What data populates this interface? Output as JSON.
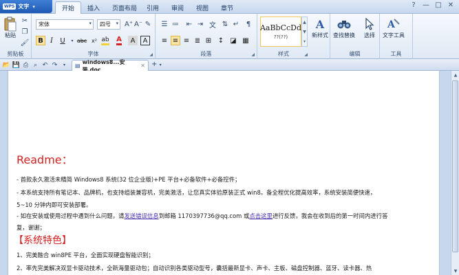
{
  "app": {
    "logo": "WPS",
    "title": "文字",
    "caret": "▾"
  },
  "tabs": [
    "开始",
    "插入",
    "页面布局",
    "引用",
    "审阅",
    "视图",
    "章节"
  ],
  "window_controls": {
    "help": "?",
    "minimize": "—",
    "maximize": "□",
    "close": "✕"
  },
  "ribbon": {
    "clipboard": {
      "paste_label": "粘贴",
      "group_label": "剪贴板"
    },
    "font": {
      "font_name": "宋体",
      "font_size": "四号",
      "group_label": "字体",
      "bold": "B",
      "italic": "I",
      "underline": "U",
      "grow": "A⁺",
      "shrink": "A⁻",
      "clear": "✎",
      "font_color_glyph": "A",
      "highlight_glyph": "ab",
      "char_shade_glyph": "A",
      "char_border_glyph": "A",
      "font_color": "#d62020",
      "highlight_color": "#f2d23a"
    },
    "paragraph": {
      "group_label": "段落"
    },
    "styles": {
      "sample": "AaBbCcDd",
      "style_name": "??(??)",
      "group_label": "样式"
    },
    "new_style": {
      "label": "新样式"
    },
    "editing": {
      "find_replace": "查找替换",
      "select": "选择",
      "group_label": "编辑"
    },
    "tools": {
      "text_tools": "文字工具",
      "group_label": "工具"
    }
  },
  "doc_tab": {
    "name": "windows8...安装.doc",
    "close": "✕",
    "add": "+",
    "add_caret": "▾"
  },
  "document": {
    "readme_heading": "Readme：",
    "line1": "- 首款永久激活未精简 Windows8 系统(32 位企业版)+PE 平台+必备软件+必备控件；",
    "line2": "- 本系统支持所有笔记本、品牌机，也支持组装兼容机，完美激活，让您真实体验原装正式 win8。备全程优化提高效率，系统安装简便快速，",
    "line3": "5~10 分钟内即可安装部署。",
    "line4_pre": "- 如在安装或使用过程中遇到什么问题，请",
    "line4_link1": "发送错误信息",
    "line4_mid": "到邮箱 1170397736@qq.com 或",
    "line4_link2": "点击这里",
    "line4_post": "进行反馈，我会在收到后的第一时间内进行答",
    "line5": "复，谢谢；",
    "features_heading": "【系统特色】",
    "feature1": "1、完美融合 win8PE 平台，全面实现硬盘智能识别；",
    "feature2": "2、率先完美解决双显卡驱动技术，全新海量驱动包；自动识别各类驱动型号，囊括最新显卡、声卡、主板、磁盘控制器、蓝牙、读卡器、热"
  }
}
